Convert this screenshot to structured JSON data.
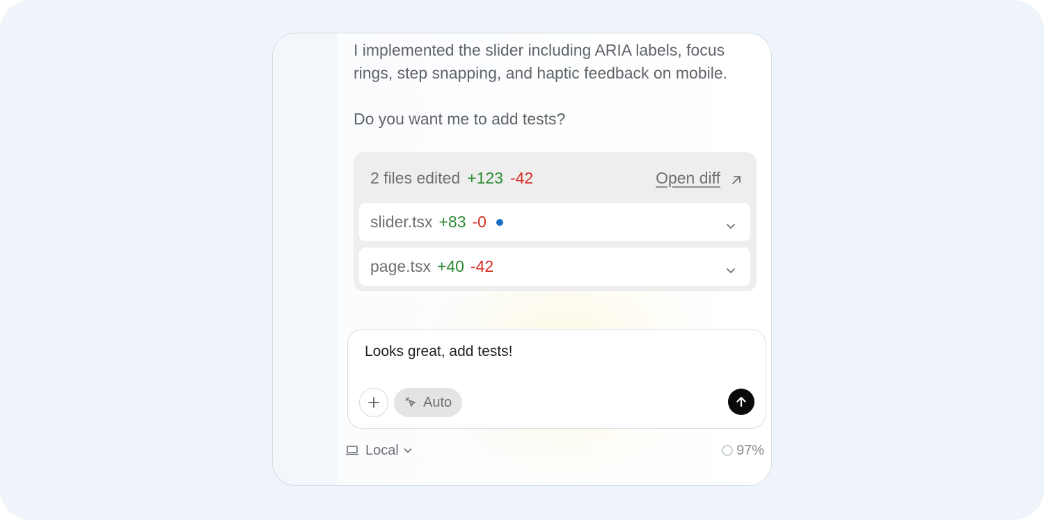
{
  "message": {
    "line1": "I implemented the slider including ARIA labels, focus rings, step snapping, and haptic feedback on mobile.",
    "line2": "Do you want me to add tests?"
  },
  "files_summary": {
    "label": "2 files edited",
    "additions": "+123",
    "deletions": "-42",
    "open_diff_label": "Open diff",
    "files": [
      {
        "name": "slider.tsx",
        "additions": "+83",
        "deletions": "-0",
        "modified_indicator": true
      },
      {
        "name": "page.tsx",
        "additions": "+40",
        "deletions": "-42",
        "modified_indicator": false
      }
    ]
  },
  "composer": {
    "text": "Looks great, add tests!",
    "mode_label": "Auto",
    "icons": {
      "add": "plus-icon",
      "mode": "cursor-click-icon",
      "send": "arrow-up-icon"
    }
  },
  "footer": {
    "environment_label": "Local",
    "context_usage": "97%",
    "icons": {
      "environment": "laptop-icon",
      "usage": "progress-ring-icon"
    }
  },
  "colors": {
    "additions": "#2e8a32",
    "deletions": "#d72b22",
    "indicator": "#1a6fc4",
    "send_button": "#0a0a0a"
  }
}
